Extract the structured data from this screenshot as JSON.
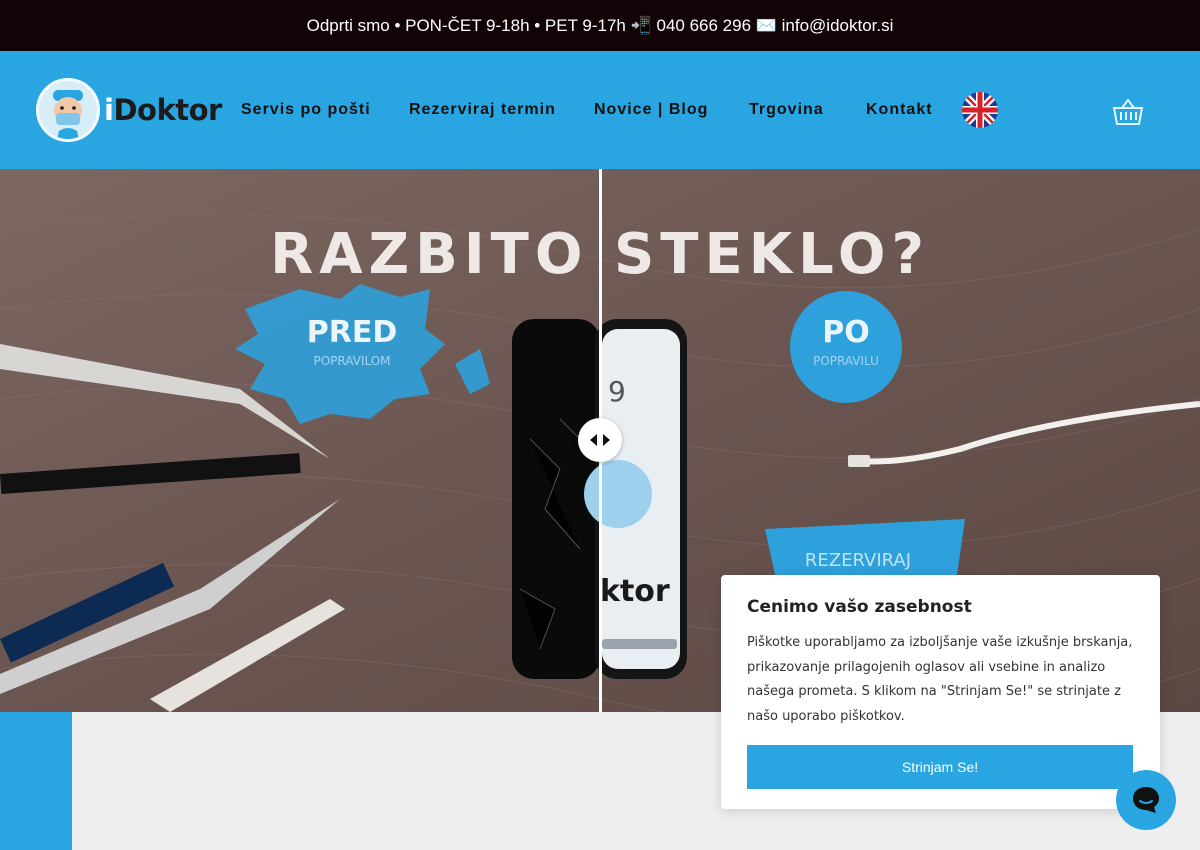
{
  "topbar": {
    "text": "Odprti smo • PON-ČET 9-18h • PET 9-17h 📲 040 666 296 ✉️ info@idoktor.si"
  },
  "header": {
    "logo_prefix": "i",
    "logo_text": "Doktor",
    "nav": [
      {
        "label": "Servis po pošti"
      },
      {
        "label": "Rezerviraj termin"
      },
      {
        "label": "Novice | Blog"
      },
      {
        "label": "Trgovina"
      },
      {
        "label": "Kontakt"
      }
    ],
    "flag_icon": "uk-flag-icon",
    "cart_icon": "basket-icon"
  },
  "hero": {
    "title": "RAZBITO STEKLO?",
    "before_label": "PRED",
    "before_sub": "POPRAVILOM",
    "after_label": "PO",
    "after_sub": "POPRAVILU",
    "phone_time": "9",
    "phone_brand": "ktor",
    "cta_label": "REZERVIRAJ"
  },
  "cookie": {
    "title": "Cenimo vašo zasebnost",
    "text": "Piškotke uporabljamo za izboljšanje vaše izkušnje brskanja, prikazovanje prilagojenih oglasov ali vsebine in analizo našega prometa. S klikom na \"Strinjam Se!\" se strinjate z našo uporabo piškotkov.",
    "button": "Strinjam Se!"
  },
  "colors": {
    "brand": "#29a6e1",
    "topbar": "#120406",
    "background": "#eeeeee"
  }
}
